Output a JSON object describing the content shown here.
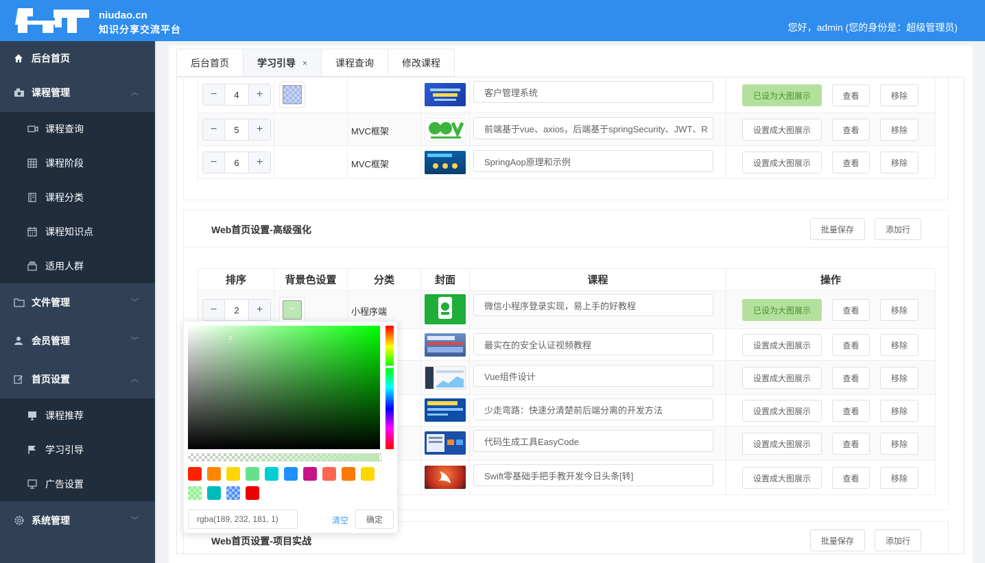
{
  "header": {
    "domain": "niudao.cn",
    "subtitle": "知识分享交流平台",
    "greeting": "您好，admin (您的身份是：超级管理员)"
  },
  "sidebar": {
    "home": "后台首页",
    "course_mgmt": "课程管理",
    "course_query": "课程查询",
    "course_stage": "课程阶段",
    "course_category": "课程分类",
    "course_knowledge": "课程知识点",
    "audience": "适用人群",
    "file_mgmt": "文件管理",
    "member_mgmt": "会员管理",
    "homepage_settings": "首页设置",
    "course_recommend": "课程推荐",
    "learning_guide": "学习引导",
    "ad_settings": "广告设置",
    "system_mgmt": "系统管理"
  },
  "tabs": {
    "home": "后台首页",
    "guide": "学习引导",
    "query": "课程查询",
    "edit": "修改课程",
    "close": "×"
  },
  "buttons": {
    "set_big": "设置成大图展示",
    "already_big": "已设为大图展示",
    "view": "查看",
    "remove": "移除",
    "batch_save": "批量保存",
    "add_row": "添加行",
    "minus": "−",
    "plus": "+"
  },
  "top_section": {
    "rows": [
      {
        "order": "4",
        "category": "",
        "course": "客户管理系统",
        "big": true
      },
      {
        "order": "5",
        "category": "MVC框架",
        "course": "前端基于vue、axios，后端基于springSecurity、JWT、R",
        "big": false
      },
      {
        "order": "6",
        "category": "MVC框架",
        "course": "SpringAop原理和示例",
        "big": false
      }
    ]
  },
  "advanced_section": {
    "title": "Web首页设置-高级强化",
    "headers": {
      "order": "排序",
      "bg": "背景色设置",
      "category": "分类",
      "cover": "封面",
      "course": "课程",
      "ops": "操作"
    },
    "rows": [
      {
        "order": "2",
        "category": "小程序端",
        "course": "微信小程序登录实现，易上手的好教程",
        "big": true
      },
      {
        "course": "最实在的安全认证视频教程",
        "big": false
      },
      {
        "course": "Vue组件设计",
        "big": false
      },
      {
        "course": "少走弯路：快速分清楚前后端分离的开发方法",
        "big": false
      },
      {
        "course": "代码生成工具EasyCode",
        "big": false
      },
      {
        "course": "Swift零基础手把手教开发今日头条[转]",
        "big": false
      }
    ]
  },
  "project_section": {
    "title": "Web首页设置-项目实战"
  },
  "color_picker": {
    "value": "rgba(189, 232, 181, 1)",
    "clear": "清空",
    "confirm": "确定",
    "presets": [
      "#ff2200",
      "#ff8800",
      "#ffd700",
      "#66e08b",
      "#00ced1",
      "#1e90ff",
      "#c71585",
      "#ff6650",
      "#ff7800",
      "#ffd700",
      "#90ee90",
      "#00bbbb",
      "#4d8ef5",
      "#ee0000"
    ]
  },
  "colors": {
    "header_bg": "#2e8ded",
    "sidebar_bg": "#304156",
    "submenu_bg": "#1f2d3d",
    "success_bg": "#b3e19d"
  }
}
